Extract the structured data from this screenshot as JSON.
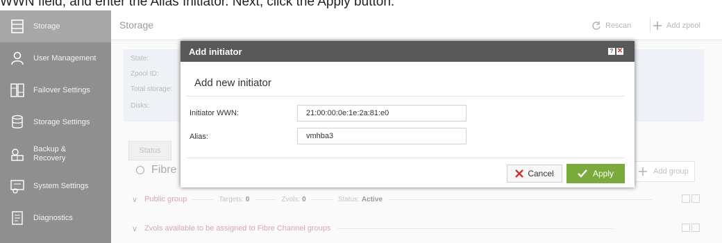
{
  "instruction": "WWN field, and enter the Alias Initiator. Next, click the Apply button.",
  "sidebar": {
    "items": [
      {
        "label": "Storage",
        "icon": "storage-icon",
        "active": true
      },
      {
        "label": "User Management",
        "icon": "users-icon"
      },
      {
        "label": "Failover Settings",
        "icon": "failover-icon"
      },
      {
        "label": "Storage Settings",
        "icon": "storage-settings-icon"
      },
      {
        "label": "Backup & Recovery",
        "icon": "backup-icon"
      },
      {
        "label": "System Settings",
        "icon": "system-settings-icon"
      },
      {
        "label": "Diagnostics",
        "icon": "diagnostics-icon"
      }
    ]
  },
  "header": {
    "title": "Storage",
    "rescan_label": "Rescan",
    "add_zpool_label": "Add zpool"
  },
  "info": {
    "labels": [
      "State:",
      "Zpool ID:",
      "Total storage:",
      "Disks:"
    ]
  },
  "tabs": {
    "status_label": "Status"
  },
  "section": {
    "title": "Fibre",
    "add_group_label": "Add group"
  },
  "groups": {
    "public": {
      "name": "Public group",
      "targets_label": "Targets:",
      "targets_value": "0",
      "zvols_label": "Zvols:",
      "zvols_value": "0",
      "status_label": "Status:",
      "status_value": "Active"
    },
    "available_text": "Zvols available to be assigned to Fibre Channel groups"
  },
  "dialog": {
    "title": "Add initiator",
    "help_label": "?",
    "close_label": "✕",
    "subtitle": "Add new initiator",
    "wwn_label": "Initiator WWN:",
    "wwn_value": "21:00:00:0e:1e:2a:81:e0",
    "alias_label": "Alias:",
    "alias_value": "vmhba3",
    "cancel_label": "Cancel",
    "apply_label": "Apply"
  },
  "colors": {
    "sidebar_bg": "#8f8f8f",
    "sidebar_active": "#a7a7a7",
    "dialog_header": "#595959",
    "apply_green": "#7aaa3c",
    "cancel_red": "#d0312d",
    "group_pink": "#d8a6b5"
  }
}
